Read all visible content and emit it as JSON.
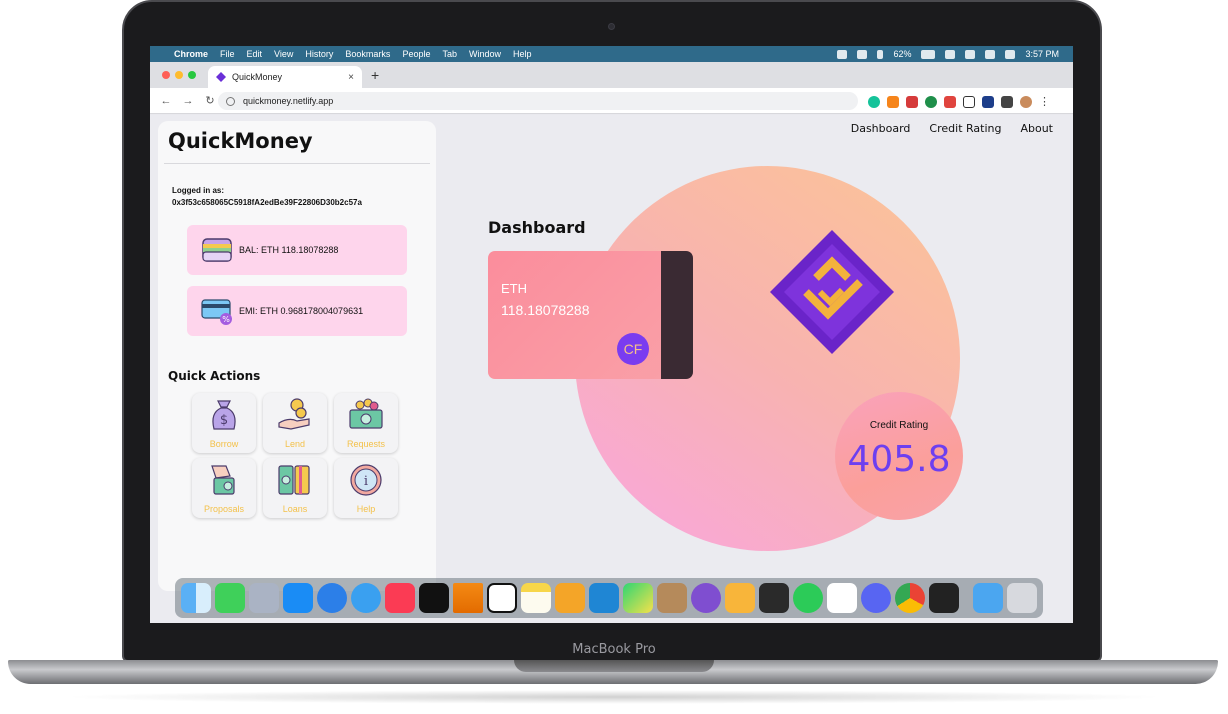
{
  "device": {
    "label": "MacBook Pro"
  },
  "menubar": {
    "app": "Chrome",
    "items": [
      "File",
      "Edit",
      "View",
      "History",
      "Bookmarks",
      "People",
      "Tab",
      "Window",
      "Help"
    ],
    "battery": "62%",
    "clock": "3:57 PM"
  },
  "browser": {
    "tab_title": "QuickMoney",
    "tab_close": "×",
    "new_tab": "+",
    "url": "quickmoney.netlify.app",
    "back": "←",
    "forward": "→",
    "reload": "↻",
    "menu": "⋮"
  },
  "sidebar": {
    "title": "QuickMoney",
    "logged_label": "Logged in as:",
    "address": "0x3f53c658065C5918fA2edBe39F22806D30b2c57a",
    "balance": "BAL: ETH 118.18078288",
    "emi": "EMI: ETH 0.968178004079631",
    "quick_actions_title": "Quick Actions",
    "actions": [
      "Borrow",
      "Lend",
      "Requests",
      "Proposals",
      "Loans",
      "Help"
    ]
  },
  "nav": {
    "items": [
      "Dashboard",
      "Credit Rating",
      "About"
    ]
  },
  "main": {
    "title": "Dashboard",
    "card_currency": "ETH",
    "card_value": "118.18078288",
    "card_badge": "CF",
    "credit_label": "Credit Rating",
    "credit_value": "405.8"
  },
  "dock": {
    "icons": [
      "finder-icon",
      "messages-icon",
      "launchpad-icon",
      "app-store-icon",
      "testflight-icon",
      "safari-icon",
      "music-icon",
      "tv-icon",
      "vlc-icon",
      "notion-icon",
      "notes-icon",
      "pages-icon",
      "vscode-icon",
      "pycharm-icon",
      "archive-icon",
      "github-icon",
      "sketch-icon",
      "final-cut-icon",
      "whatsapp-icon",
      "slack-icon",
      "discord-icon",
      "chrome-icon",
      "terminal-icon",
      "downloads-icon",
      "trash-icon"
    ]
  },
  "colors": {
    "menubar": "#2f6a8a",
    "card_pink": "#fed5ec",
    "accent_purple": "#6d3ff0",
    "action_label": "#f3c14a"
  }
}
